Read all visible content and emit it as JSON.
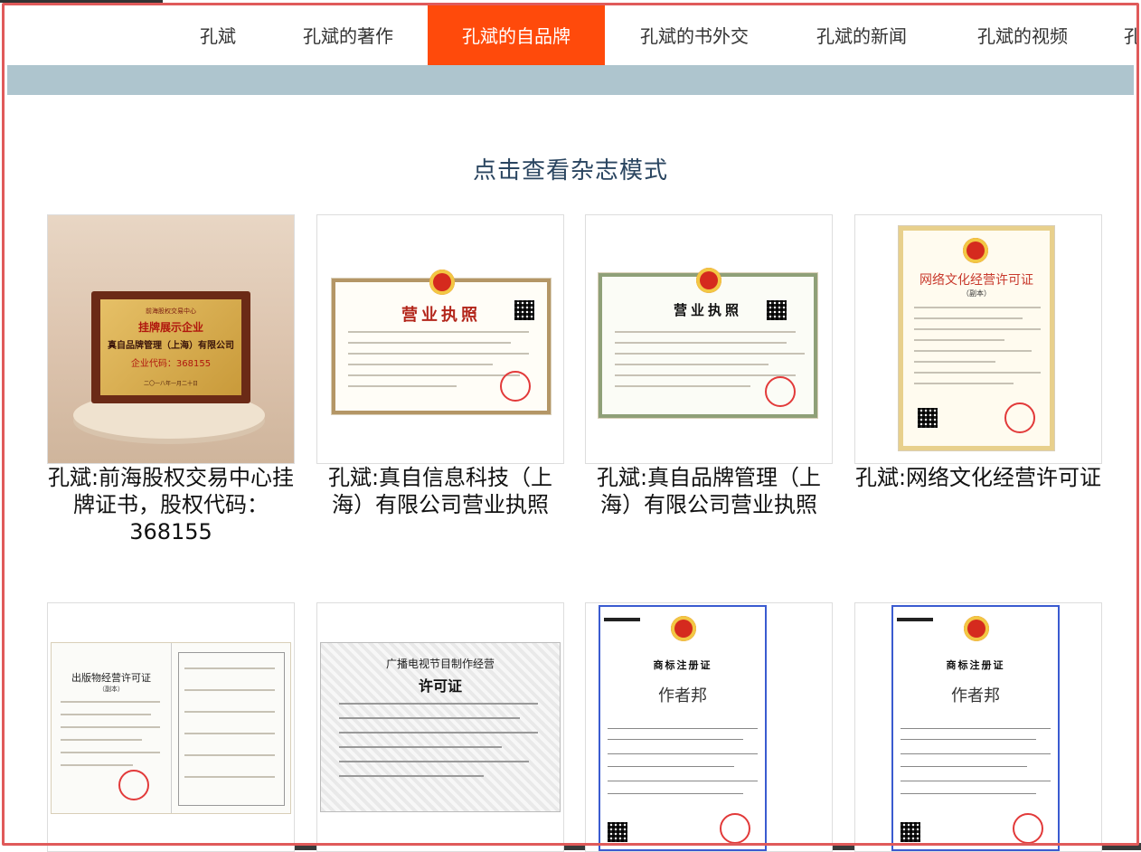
{
  "nav": {
    "items": [
      {
        "label": "孔斌"
      },
      {
        "label": "孔斌的著作"
      },
      {
        "label": "孔斌的自品牌"
      },
      {
        "label": "孔斌的书外交"
      },
      {
        "label": "孔斌的新闻"
      },
      {
        "label": "孔斌的视频"
      },
      {
        "label": "孔"
      }
    ],
    "active_index": 2,
    "active_color": "#ff4a0b"
  },
  "section_title": "点击查看杂志模式",
  "cards": [
    {
      "caption": "孔斌:前海股权交易中心挂牌证书，股权代码：368155",
      "image": {
        "plaque_org": "前海股权交易中心",
        "plaque_heading": "挂牌展示企业",
        "plaque_company": "真自品牌管理（上海）有限公司",
        "plaque_code": "企业代码：368155",
        "plaque_date": "二〇一八年一月二十日"
      }
    },
    {
      "caption": "孔斌:真自信息科技（上海）有限公司营业执照",
      "image": {
        "heading": "营业执照"
      }
    },
    {
      "caption": "孔斌:真自品牌管理（上海）有限公司营业执照",
      "image": {
        "heading": "营业执照"
      }
    },
    {
      "caption": "孔斌:网络文化经营许可证",
      "image": {
        "heading": "网络文化经营许可证",
        "sub": "（副本）"
      }
    },
    {
      "caption": "",
      "image": {
        "heading": "出版物经营许可证",
        "sub": "（副本）"
      }
    },
    {
      "caption": "",
      "image": {
        "heading_top": "广播电视节目制作经营",
        "heading": "许可证"
      }
    },
    {
      "caption": "",
      "image": {
        "heading": "商标注册证",
        "mark": "作者邦"
      }
    },
    {
      "caption": "",
      "image": {
        "heading": "商标注册证",
        "mark": "作者邦"
      }
    }
  ]
}
